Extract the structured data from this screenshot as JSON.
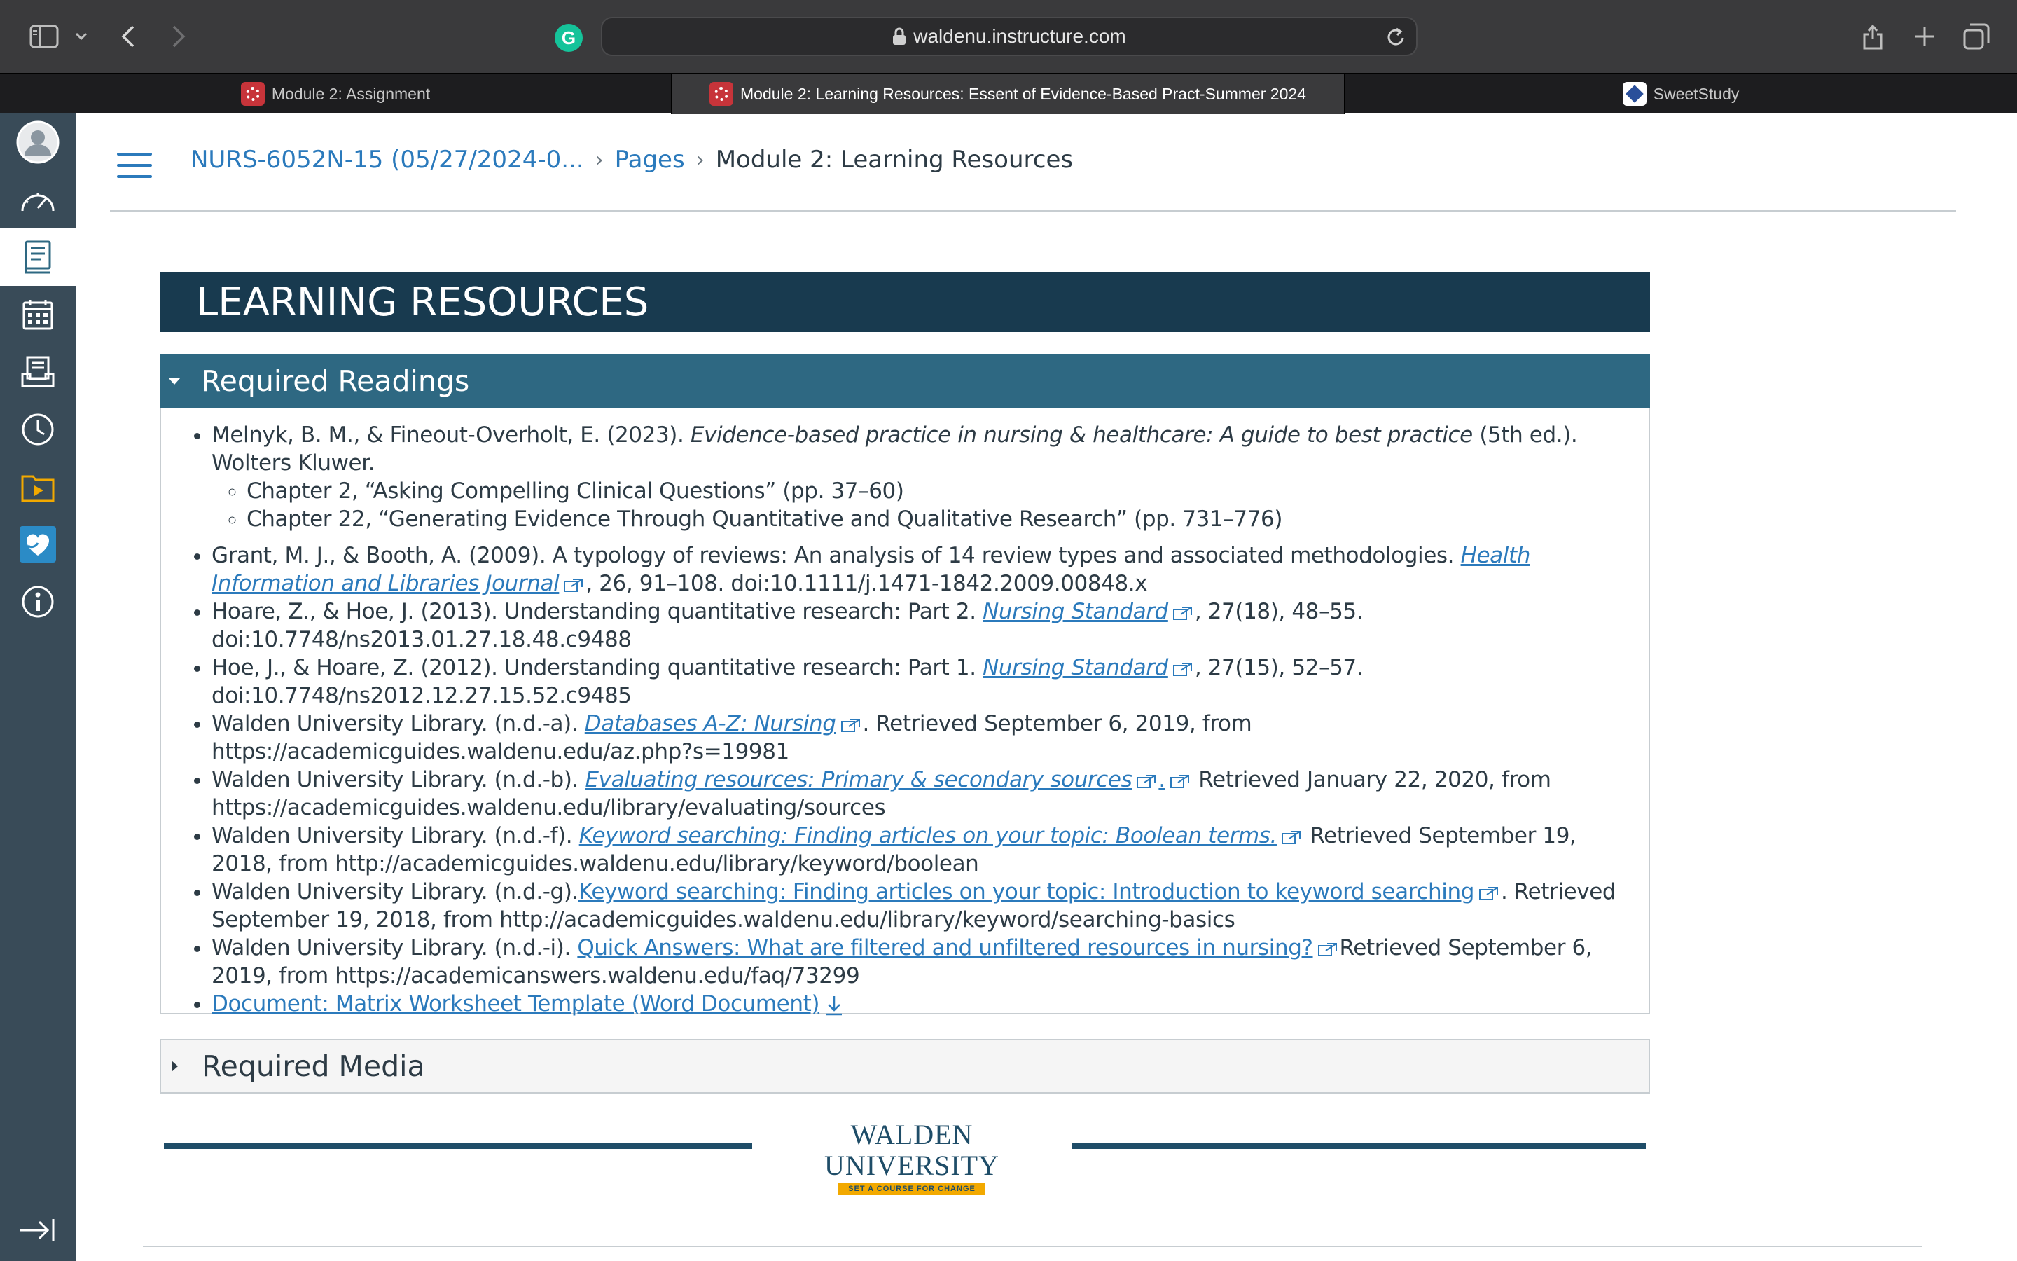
{
  "browser": {
    "url": "waldenu.instructure.com",
    "tabs": [
      {
        "label": "Module 2: Assignment",
        "active": false
      },
      {
        "label": "Module 2: Learning Resources: Essent of Evidence-Based Pract-Summer 2024",
        "active": true
      },
      {
        "label": "SweetStudy",
        "active": false
      }
    ],
    "extension_icon_letter": "G",
    "icons": [
      "sidebar-icon",
      "chevron-down-icon",
      "back-icon",
      "forward-icon",
      "lock-icon",
      "reload-icon",
      "share-icon",
      "new-tab-icon",
      "tab-overview-icon"
    ]
  },
  "global_nav": {
    "items": [
      "account-icon",
      "dashboard-icon",
      "courses-icon",
      "calendar-icon",
      "inbox-icon",
      "history-icon",
      "studio-icon",
      "wellness-icon",
      "help-icon"
    ],
    "active": "courses-icon",
    "collapse_icon": "collapse-nav-icon"
  },
  "breadcrumb": {
    "course": "NURS-6052N-15 (05/27/2024-0...",
    "pages": "Pages",
    "current": "Module 2: Learning Resources"
  },
  "banner_title": "LEARNING RESOURCES",
  "required_readings": {
    "title": "Required Readings",
    "expanded": true,
    "melnyk": {
      "pre": "Melnyk, B. M., & Fineout-Overholt, E. (2023). ",
      "em": "Evidence-based practice in nursing & healthcare: A guide to best practice",
      "post": " (5th ed.). Wolters Kluwer.",
      "chapters": [
        "Chapter 2, “Asking Compelling Clinical Questions” (pp. 37–60)",
        "Chapter 22, “Generating Evidence Through Quantitative and Qualitative Research” (pp. 731–776)"
      ]
    },
    "grant": {
      "pre": "Grant, M. J., & Booth, A. (2009). A typology of reviews: An analysis of 14 review types and associated methodologies. ",
      "link": "Health Information and Libraries Journal",
      "post": ", 26, 91–108. doi:10.1111/j.1471-1842.2009.00848.x"
    },
    "hoare": {
      "pre": "Hoare, Z., & Hoe, J. (2013). Understanding quantitative research: Part 2. ",
      "link": "Nursing Standard",
      "post": ", 27(18), 48–55. doi:10.7748/ns2013.01.27.18.48.c9488"
    },
    "hoe": {
      "pre": "Hoe, J., & Hoare, Z. (2012). Understanding quantitative research: Part 1. ",
      "link": "Nursing Standard",
      "post": ", 27(15), 52–57. doi:10.7748/ns2012.12.27.15.52.c9485"
    },
    "walden_a": {
      "pre": "Walden University Library. (n.d.-a). ",
      "link": "Databases A-Z: Nursing",
      "post": ". Retrieved September 6, 2019, from https://academicguides.waldenu.edu/az.php?s=19981"
    },
    "walden_b": {
      "pre": "Walden University Library. (n.d.-b). ",
      "link": "Evaluating resources: Primary & secondary sources",
      "link2": ".",
      "post": " Retrieved January 22, 2020, from https://academicguides.waldenu.edu/library/evaluating/sources"
    },
    "walden_f": {
      "pre": "Walden University Library. (n.d.-f). ",
      "link": "Keyword searching: Finding articles on your topic: Boolean terms.",
      "post": " Retrieved September 19, 2018, from http://academicguides.waldenu.edu/library/keyword/boolean"
    },
    "walden_g": {
      "pre": "Walden University Library. (n.d.-g).",
      "link": "Keyword searching: Finding articles on your topic: Introduction to keyword searching",
      "post": ". Retrieved September 19, 2018, from http://academicguides.waldenu.edu/library/keyword/searching-basics"
    },
    "walden_i": {
      "pre": "Walden University Library. (n.d.-i). ",
      "link": "Quick Answers: What are filtered and unfiltered resources in nursing?",
      "post": "Retrieved September 6, 2019, from https://academicanswers.waldenu.edu/faq/73299"
    },
    "matrix_doc": "Document: Matrix Worksheet Template (Word Document)"
  },
  "required_media": {
    "title": "Required Media",
    "expanded": false
  },
  "footer": {
    "logo_name": "WALDEN UNIVERSITY",
    "logo_tagline": "SET A COURSE FOR CHANGE"
  },
  "colors": {
    "link": "#2b7abc",
    "banner": "#183a4f",
    "accordion_active": "#2e6882",
    "nav": "#394b58",
    "logo_gold": "#f2a900"
  }
}
